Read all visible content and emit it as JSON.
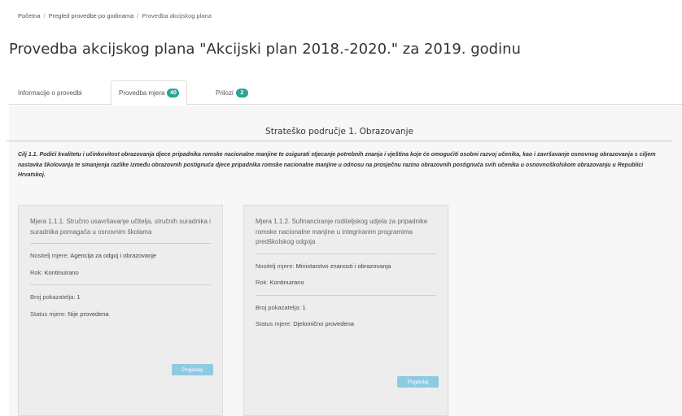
{
  "breadcrumb": {
    "home": "Početna",
    "level2": "Pregled provedbe po godinama",
    "current": "Provedba akcijskog plana"
  },
  "page": {
    "title": "Provedba akcijskog plana \"Akcijski plan 2018.-2020.\" za 2019. godinu"
  },
  "tabs": [
    {
      "label": "Informacije o provedbi",
      "badge": ""
    },
    {
      "label": "Provedba mjera",
      "badge": "40"
    },
    {
      "label": "Prilozi",
      "badge": "2"
    }
  ],
  "section": {
    "title": "Strateško područje 1. Obrazovanje",
    "goal_label": "Cilj 1.1.",
    "goal_text": "Podići kvalitetu i učinkovitost obrazovanja djece pripadnika romske nacionalne manjine te osigurati stjecanje potrebnih znanja i vještina koje će omogućiti osobni razvoj učenika, kao i završavanje osnovnog obrazovanja s ciljem nastavka školovanja te smanjenja razlike između obrazovnih postignuća djece pripadnika romske nacionalne manjine u odnosu na prosječnu razinu obrazovnih postignuća svih učenika u osnovnoškolskom obrazovanju u Republici Hrvatskoj."
  },
  "cards": [
    {
      "title": "Mjera 1.1.1. Stručno usavršavanje učitelja, stručnih suradnika i suradnika pomagača u osnovnim školama",
      "holder_label": "Nositelj mjere:",
      "holder_value": "Agencija za odgoj i obrazovanje",
      "deadline_label": "Rok:",
      "deadline_value": "Kontinuirano",
      "indicators_label": "Broj pokazatelja:",
      "indicators_value": "1",
      "status_label": "Status mjere:",
      "status_value": "Nije provedena",
      "button": "Pogledaj"
    },
    {
      "title": "Mjera 1.1.2. Sufinanciranje roditeljskog udjela za pripadnike romske nacionalne manjine u integriranim programima predškolskog odgoja",
      "holder_label": "Nositelj mjere:",
      "holder_value": "Ministarstvo znanosti i obrazovanja",
      "deadline_label": "Rok:",
      "deadline_value": "Kontinuirano",
      "indicators_label": "Broj pokazatelja:",
      "indicators_value": "1",
      "status_label": "Status mjere:",
      "status_value": "Djelomično provedena",
      "button": "Pogledaj"
    }
  ]
}
